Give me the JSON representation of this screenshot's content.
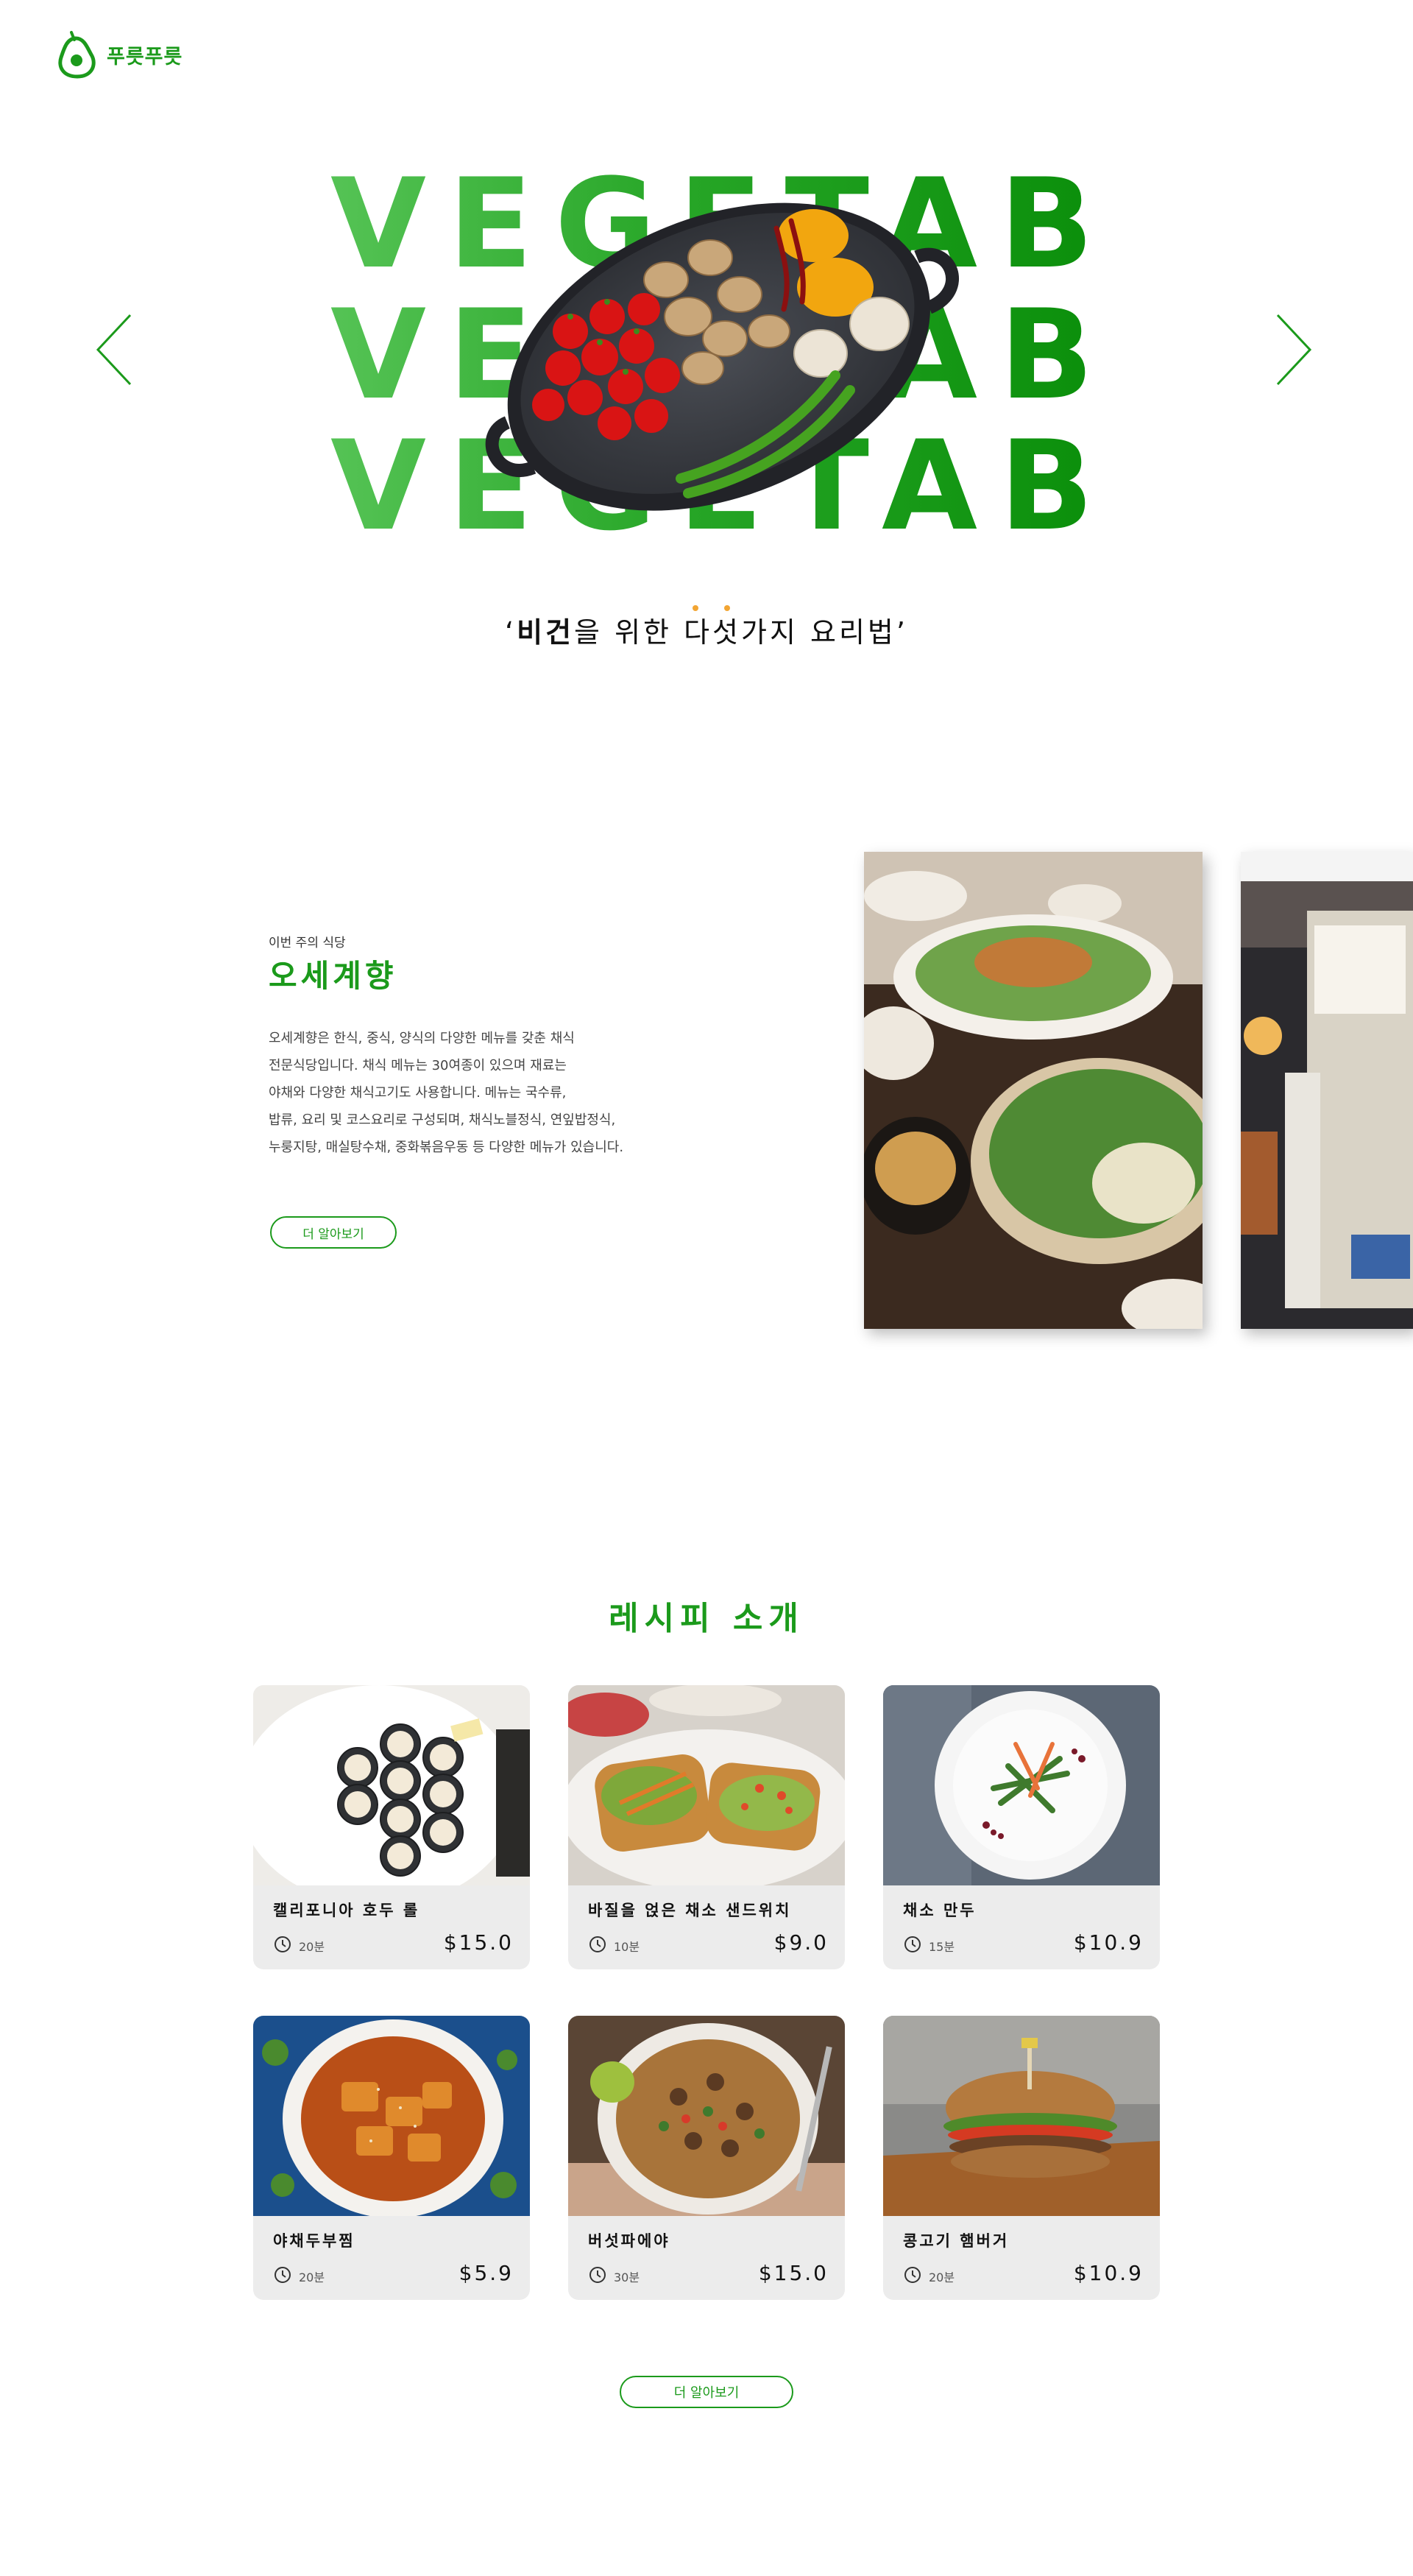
{
  "brand": {
    "name": "푸릇푸릇",
    "accent": "#1b9a1b"
  },
  "hero": {
    "words": [
      "VEGETABLE",
      "VEGETABLE",
      "VEGETABLE"
    ],
    "tagline_bold": "비건",
    "tagline_rest": "을 위한 다섯가지 요리법",
    "quote_open": "‘",
    "quote_close": "’",
    "prev_icon": "chevron-left-icon",
    "next_icon": "chevron-right-icon"
  },
  "restaurant": {
    "subtitle": "이번 주의 식당",
    "title": "오세계향",
    "description": [
      "오세계향은 한식, 중식, 양식의 다양한 메뉴를 갖춘 채식",
      "전문식당입니다. 채식 메뉴는 30여종이 있으며 재료는",
      "야채와 다양한 채식고기도 사용합니다. 메뉴는 국수류,",
      "밥류, 요리 및 코스요리로 구성되며, 채식노블정식, 연잎밥정식,",
      "누룽지탕, 매실탕수채, 중화볶음우동 등 다양한 메뉴가 있습니다."
    ],
    "button_label": "더 알아보기"
  },
  "recipes": {
    "title": "레시피 소개",
    "items": [
      {
        "name": "캘리포니아 호두 롤",
        "time": "20분",
        "price": "$15.0"
      },
      {
        "name": "바질을 얹은 채소 샌드위치",
        "time": "10분",
        "price": "$9.0"
      },
      {
        "name": "채소 만두",
        "time": "15분",
        "price": "$10.9"
      },
      {
        "name": "야채두부찜",
        "time": "20분",
        "price": "$5.9"
      },
      {
        "name": "버섯파에야",
        "time": "30분",
        "price": "$15.0"
      },
      {
        "name": "콩고기 햄버거",
        "time": "20분",
        "price": "$10.9"
      }
    ],
    "button_label": "더 알아보기"
  }
}
